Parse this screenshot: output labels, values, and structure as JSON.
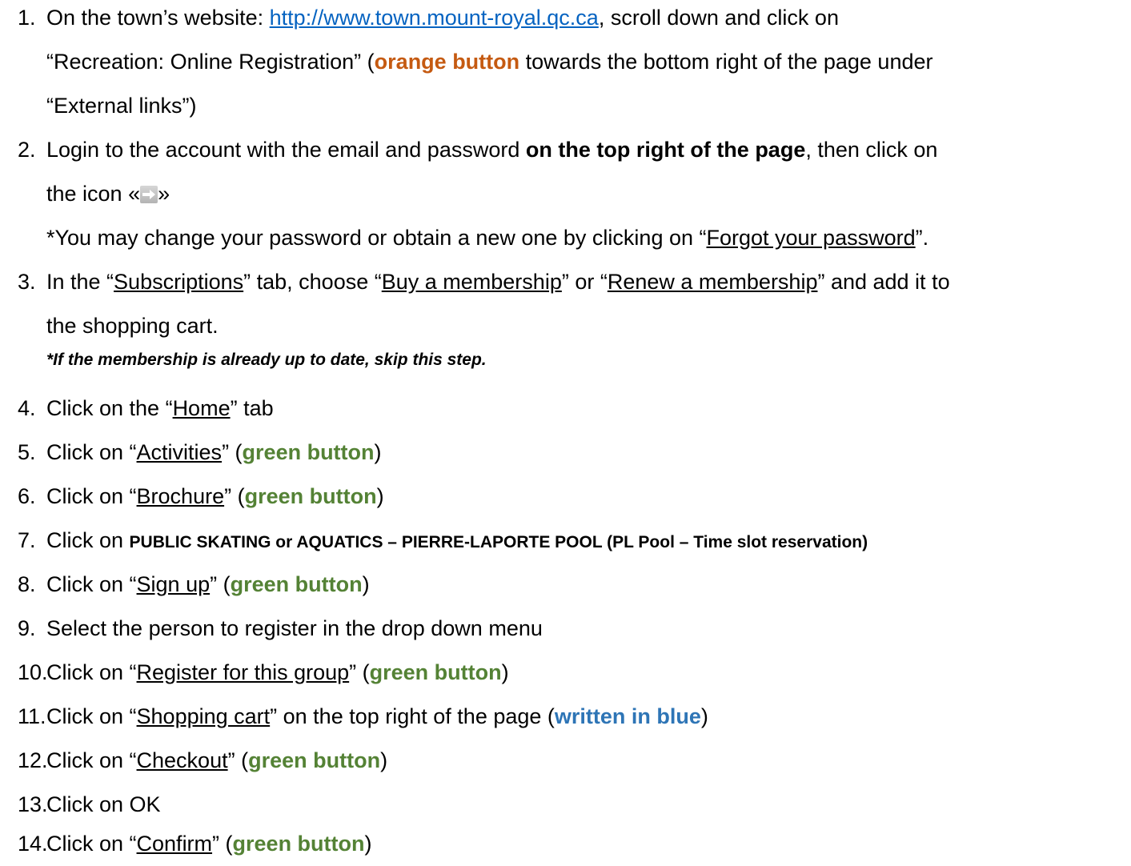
{
  "steps": [
    {
      "num": "1.",
      "line1_pre": "On the town’s website: ",
      "link": "http://www.town.mount-royal.qc.ca",
      "line1_post": ", scroll down and click on",
      "line2_pre": "“Recreation: Online Registration” (",
      "line2_orange": "orange button",
      "line2_post": " towards the bottom right of the page under",
      "line3": "“External links”)"
    },
    {
      "num": "2.",
      "line1_pre": "Login to the account with the email and password ",
      "line1_bold": "on the top right of the page",
      "line1_post": ", then click on",
      "line2_pre": "the icon «",
      "line2_post": "»",
      "note_pre": "*You may change your password or obtain a new one by clicking on “",
      "note_link": "Forgot your password",
      "note_post": "”."
    },
    {
      "num": "3.",
      "l1a": "In the “",
      "l1b": "Subscriptions",
      "l1c": "” tab, choose “",
      "l1d": "Buy a membership",
      "l1e": "” or “",
      "l1f": "Renew a membership",
      "l1g": "” and add it to",
      "line2": "the shopping cart.",
      "note": "*If the membership is already up to date, skip this step."
    },
    {
      "num": "4.",
      "pre": "Click on the “",
      "u": "Home",
      "post": "” tab"
    },
    {
      "num": "5.",
      "pre": "Click on “",
      "u": "Activities",
      "mid": "” (",
      "green": "green button",
      "post": ")"
    },
    {
      "num": "6.",
      "pre": "Click on “",
      "u": "Brochure",
      "mid": "” (",
      "green": "green button",
      "post": ")"
    },
    {
      "num": "7.",
      "pre": "Click on ",
      "bold": "PUBLIC SKATING or  AQUATICS – PIERRE-LAPORTE POOL (PL Pool – Time slot reservation)"
    },
    {
      "num": "8.",
      "pre": "Click on “",
      "u": "Sign up",
      "mid": "” (",
      "green": "green button",
      "post": ")"
    },
    {
      "num": "9.",
      "text": "Select the person to register in the drop down menu"
    },
    {
      "num": "10.",
      "pre": "Click on “",
      "u": "Register for this group",
      "mid": "” (",
      "green": "green button",
      "post": ")"
    },
    {
      "num": "11.",
      "pre": "Click on “",
      "u": "Shopping cart",
      "mid": "” on the top right of the page (",
      "blue": "written in blue",
      "post": ")"
    },
    {
      "num": "12.",
      "pre": "Click on “",
      "u": "Checkout",
      "mid": "” (",
      "green": "green button",
      "post": ")"
    },
    {
      "num": "13.",
      "text": "Click on OK"
    },
    {
      "num": "14.",
      "pre": "Click on “",
      "u": "Confirm",
      "mid": "” (",
      "green": "green button",
      "post": ")"
    }
  ],
  "colors": {
    "link": "#0563c1",
    "orange": "#c55a11",
    "green": "#548235",
    "blue": "#2e75b6"
  },
  "icons": {
    "login_arrow": "arrow-right-icon"
  }
}
